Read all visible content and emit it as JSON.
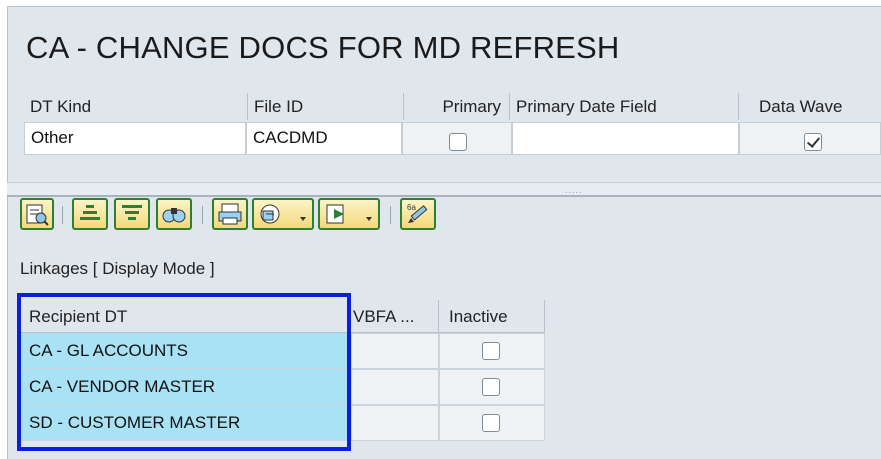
{
  "header": {
    "title": "CA - CHANGE DOCS FOR MD REFRESH",
    "columns": [
      "DT Kind",
      "File ID",
      "Primary",
      "Primary Date Field",
      "Data Wave"
    ],
    "values": {
      "dt_kind": "Other",
      "file_id": "CACDMD",
      "primary_checked": false,
      "primary_date_field": "",
      "data_wave_checked": true
    }
  },
  "splitter": {
    "grip": "....."
  },
  "toolbar": {
    "buttons": [
      "details-icon",
      "sort-ascending-icon",
      "filter-icon",
      "find-icon",
      "print-icon",
      "view-dropdown-icon",
      "export-dropdown-icon",
      "edit-icon"
    ]
  },
  "linkages": {
    "title": "Linkages [ Display Mode ]",
    "columns": [
      "Recipient DT",
      "VBFA ...",
      "Inactive"
    ],
    "rows": [
      {
        "recipient": "CA - GL ACCOUNTS",
        "vbfa": "",
        "inactive": false
      },
      {
        "recipient": "CA - VENDOR MASTER",
        "vbfa": "",
        "inactive": false
      },
      {
        "recipient": "SD - CUSTOMER MASTER",
        "vbfa": "",
        "inactive": false
      }
    ]
  },
  "colors": {
    "background": "#dfe6ec",
    "row_highlight": "#a9e2f5",
    "annotation_box": "#0b1fe0",
    "toolbar_border": "#2d7f34"
  }
}
